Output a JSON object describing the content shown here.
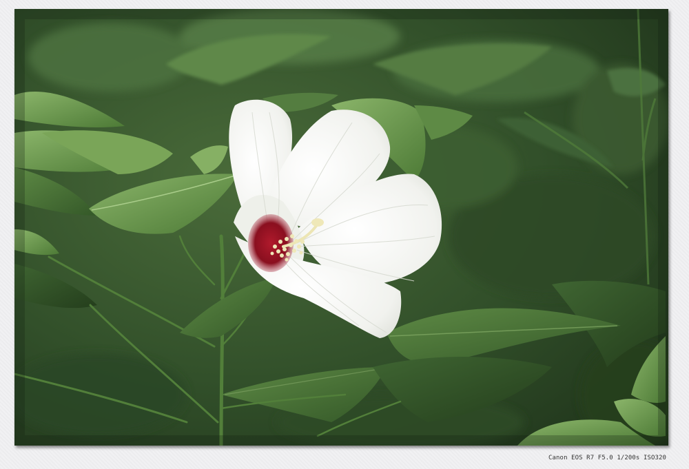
{
  "photo": {
    "subject": "white-hibiscus-flower",
    "colors": {
      "background_dark": "#23391d",
      "background_mid": "#3c5c30",
      "leaf_light": "#6e9a4e",
      "leaf_mid": "#4f7a3a",
      "petal_white": "#f4f4f0",
      "petal_shadow": "#d9dbd4",
      "center_red": "#8a0f1f",
      "stamen_cream": "#efe8b8"
    }
  },
  "caption": {
    "exif_text": "Canon EOS R7 F5.0 1/200s ISO320"
  }
}
